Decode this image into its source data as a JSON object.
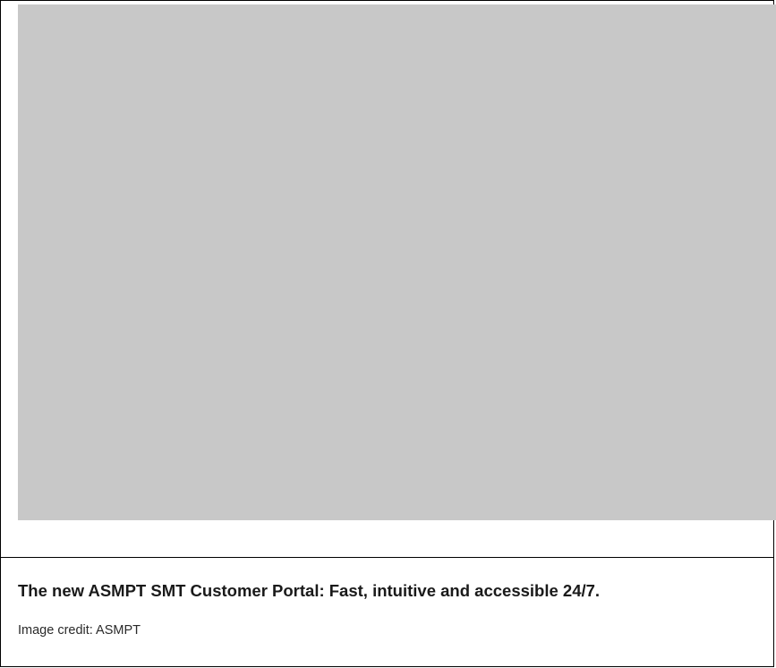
{
  "figure": {
    "caption": "The new ASMPT SMT Customer Portal: Fast, intuitive and accessible 24/7.",
    "credit": "Image credit: ASMPT"
  }
}
